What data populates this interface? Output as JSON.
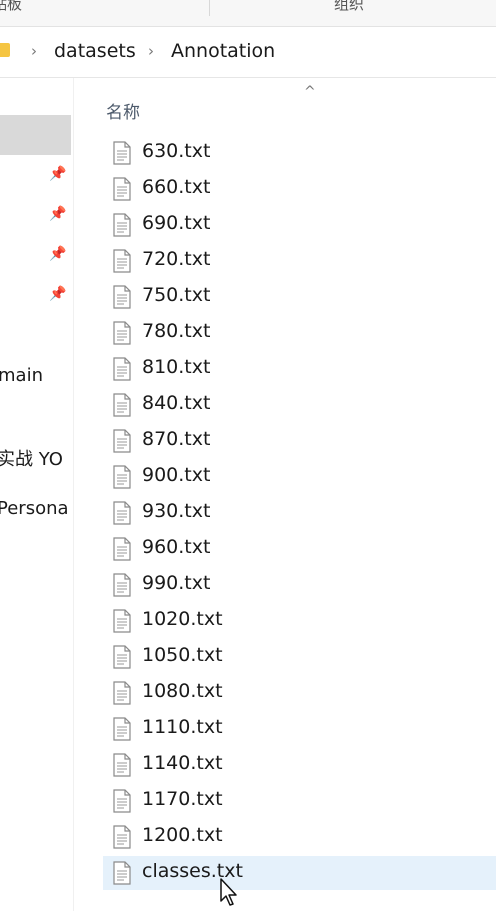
{
  "ribbon": {
    "left_label": "贴板",
    "right_label": "组织"
  },
  "address": {
    "crumbs": [
      "datasets",
      "Annotation"
    ],
    "separator": "›"
  },
  "nav": {
    "labels": [
      "main",
      "实战 YO",
      "Persona"
    ]
  },
  "content": {
    "sort_caret": "^",
    "column_header": "名称",
    "files": [
      {
        "name": "630.txt"
      },
      {
        "name": "660.txt"
      },
      {
        "name": "690.txt"
      },
      {
        "name": "720.txt"
      },
      {
        "name": "750.txt"
      },
      {
        "name": "780.txt"
      },
      {
        "name": "810.txt"
      },
      {
        "name": "840.txt"
      },
      {
        "name": "870.txt"
      },
      {
        "name": "900.txt"
      },
      {
        "name": "930.txt"
      },
      {
        "name": "960.txt"
      },
      {
        "name": "990.txt"
      },
      {
        "name": "1020.txt"
      },
      {
        "name": "1050.txt"
      },
      {
        "name": "1080.txt"
      },
      {
        "name": "1110.txt"
      },
      {
        "name": "1140.txt"
      },
      {
        "name": "1170.txt"
      },
      {
        "name": "1200.txt"
      },
      {
        "name": "classes.txt",
        "selected": true
      }
    ]
  },
  "colors": {
    "selection": "#e5f1fb",
    "nav_selected": "#d9d9d9",
    "folder": "#f5c542"
  }
}
